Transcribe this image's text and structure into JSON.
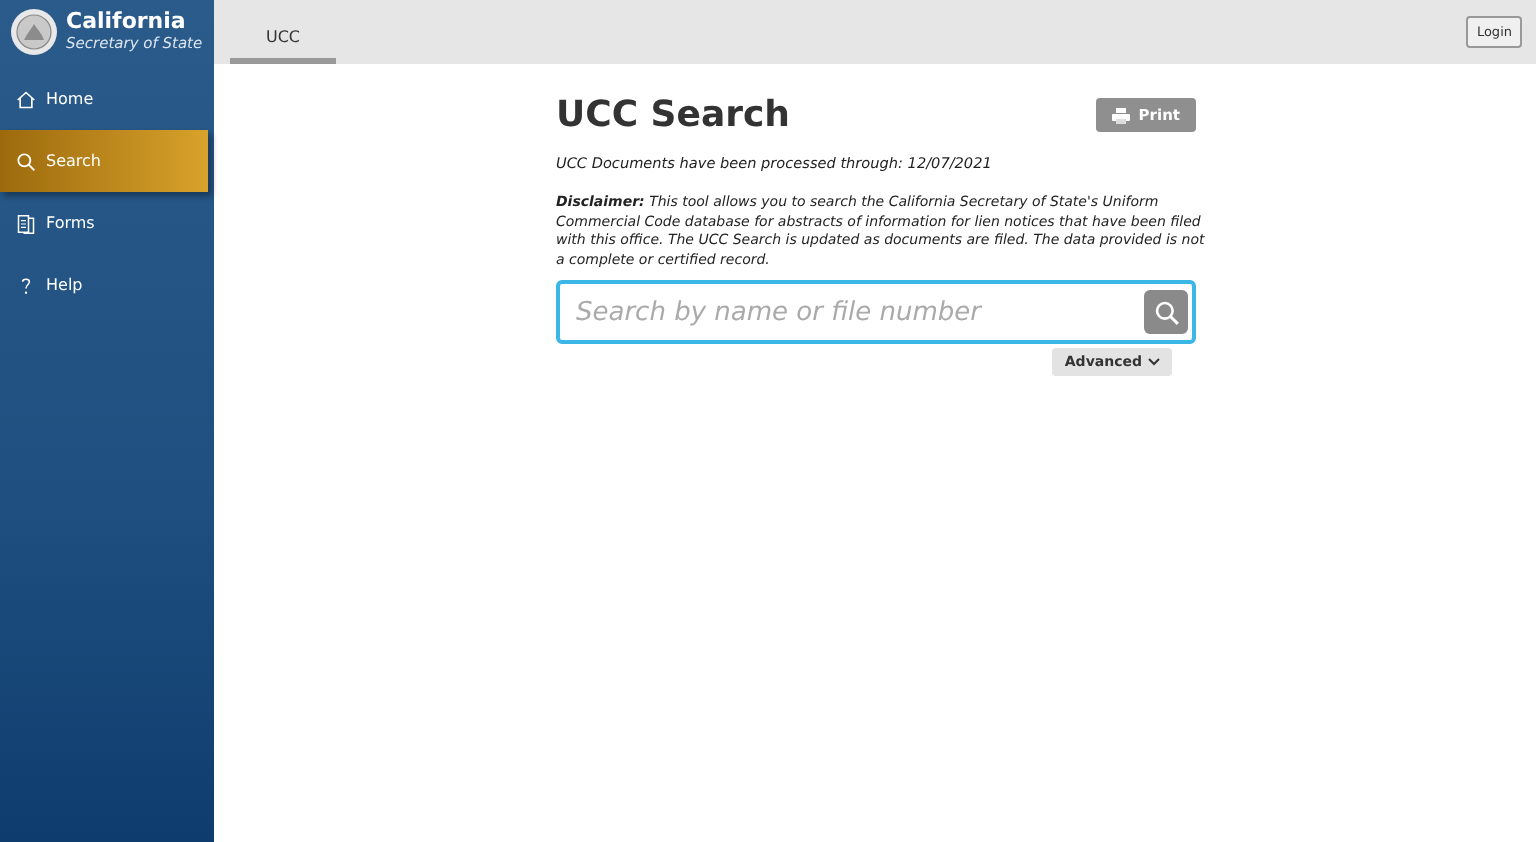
{
  "brand": {
    "title": "California",
    "subtitle": "Secretary of State"
  },
  "sidebar": {
    "items": [
      {
        "label": "Home",
        "selected": false
      },
      {
        "label": "Search",
        "selected": true
      },
      {
        "label": "Forms",
        "selected": false
      },
      {
        "label": "Help",
        "selected": false
      }
    ]
  },
  "tabs": [
    {
      "label": "UCC",
      "selected": true
    }
  ],
  "login": "Login",
  "page": {
    "title": "UCC Search",
    "print": "Print",
    "processed": "UCC Documents have been processed through: 12/07/2021",
    "disclaimer": "**Disclaimer:** This tool allows you to search the California Secretary of State's Uniform Commercial Code database for abstracts of information for lien notices that have been filed with this office. The UCC Search is updated as documents are filed. The data provided is not a complete or certified record.",
    "search": {
      "placeholder": "Search by name or file number"
    },
    "advanced": "Advanced"
  }
}
